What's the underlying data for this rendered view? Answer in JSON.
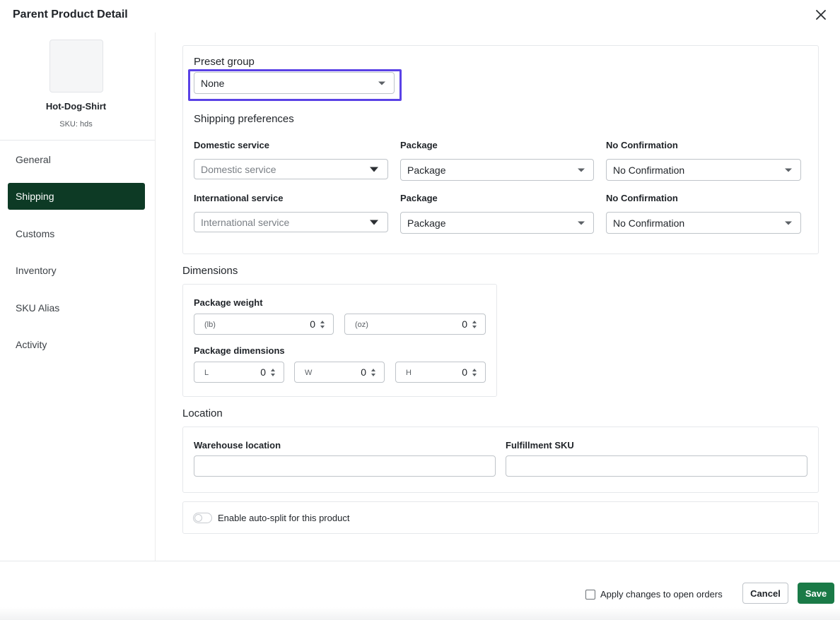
{
  "header": {
    "title": "Parent Product Detail"
  },
  "product": {
    "name": "Hot-Dog-Shirt",
    "sku_label": "SKU:",
    "sku_value": "hds"
  },
  "sidebar": {
    "items": [
      {
        "label": "General"
      },
      {
        "label": "Shipping",
        "active": true
      },
      {
        "label": "Customs"
      },
      {
        "label": "Inventory"
      },
      {
        "label": "SKU Alias"
      },
      {
        "label": "Activity"
      }
    ]
  },
  "preset": {
    "heading": "Preset group",
    "value": "None"
  },
  "shipping": {
    "heading": "Shipping preferences",
    "domestic": {
      "service_label": "Domestic service",
      "service_placeholder": "Domestic service",
      "package_label": "Package",
      "package_value": "Package",
      "confirmation_label": "No Confirmation",
      "confirmation_value": "No Confirmation"
    },
    "international": {
      "service_label": "International service",
      "service_placeholder": "International service",
      "package_label": "Package",
      "package_value": "Package",
      "confirmation_label": "No Confirmation",
      "confirmation_value": "No Confirmation"
    }
  },
  "dimensions": {
    "heading": "Dimensions",
    "weight_label": "Package weight",
    "lb_unit": "(lb)",
    "lb_value": "0",
    "oz_unit": "(oz)",
    "oz_value": "0",
    "dims_label": "Package dimensions",
    "l_unit": "L",
    "l_value": "0",
    "w_unit": "W",
    "w_value": "0",
    "h_unit": "H",
    "h_value": "0"
  },
  "location": {
    "heading": "Location",
    "warehouse_label": "Warehouse location",
    "warehouse_value": "",
    "fulfillment_label": "Fulfillment SKU",
    "fulfillment_value": ""
  },
  "autosplit": {
    "label": "Enable auto-split for this product",
    "enabled": false
  },
  "footer": {
    "apply_label": "Apply changes to open orders",
    "cancel_label": "Cancel",
    "save_label": "Save"
  },
  "colors": {
    "active_nav": "#0d3a25",
    "save_button": "#1a7a47",
    "highlight": "#5a42e6"
  }
}
